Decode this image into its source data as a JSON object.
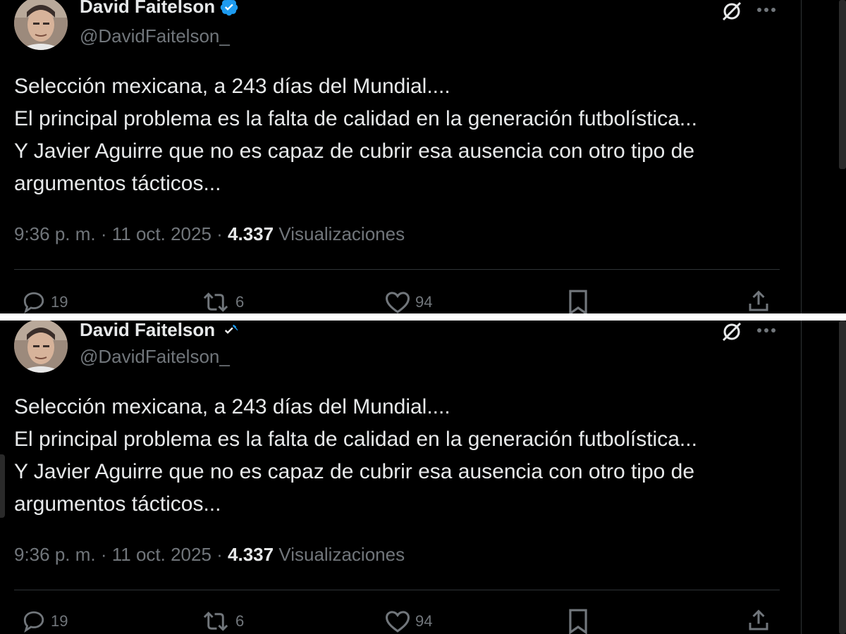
{
  "tweet": {
    "author_name": "David Faitelson",
    "author_handle": "@DavidFaitelson_",
    "text_lines": [
      "Selección mexicana, a 243 días del Mundial....",
      "El principal problema es la falta de calidad en la generación futbolística...",
      "Y Javier Aguirre que no es capaz de cubrir esa ausencia con otro tipo de",
      "argumentos tácticos..."
    ],
    "time": "9:36 p. m.",
    "sep1": " · ",
    "date": "11 oct. 2025",
    "sep2": " · ",
    "views_count": "4.337",
    "views_label": " Visualizaciones",
    "replies": "19",
    "reposts": "6",
    "likes": "94"
  },
  "icons": {
    "verified": "verified-badge-icon",
    "grok": "grok-icon",
    "more": "more-options-icon",
    "reply": "reply-icon",
    "repost": "repost-icon",
    "like": "like-icon",
    "bookmark": "bookmark-icon",
    "share": "share-icon"
  },
  "colors": {
    "background": "#000000",
    "text": "#e7e9ea",
    "secondary": "#71767b",
    "verified": "#1d9bf0",
    "divider": "#2f3336"
  }
}
